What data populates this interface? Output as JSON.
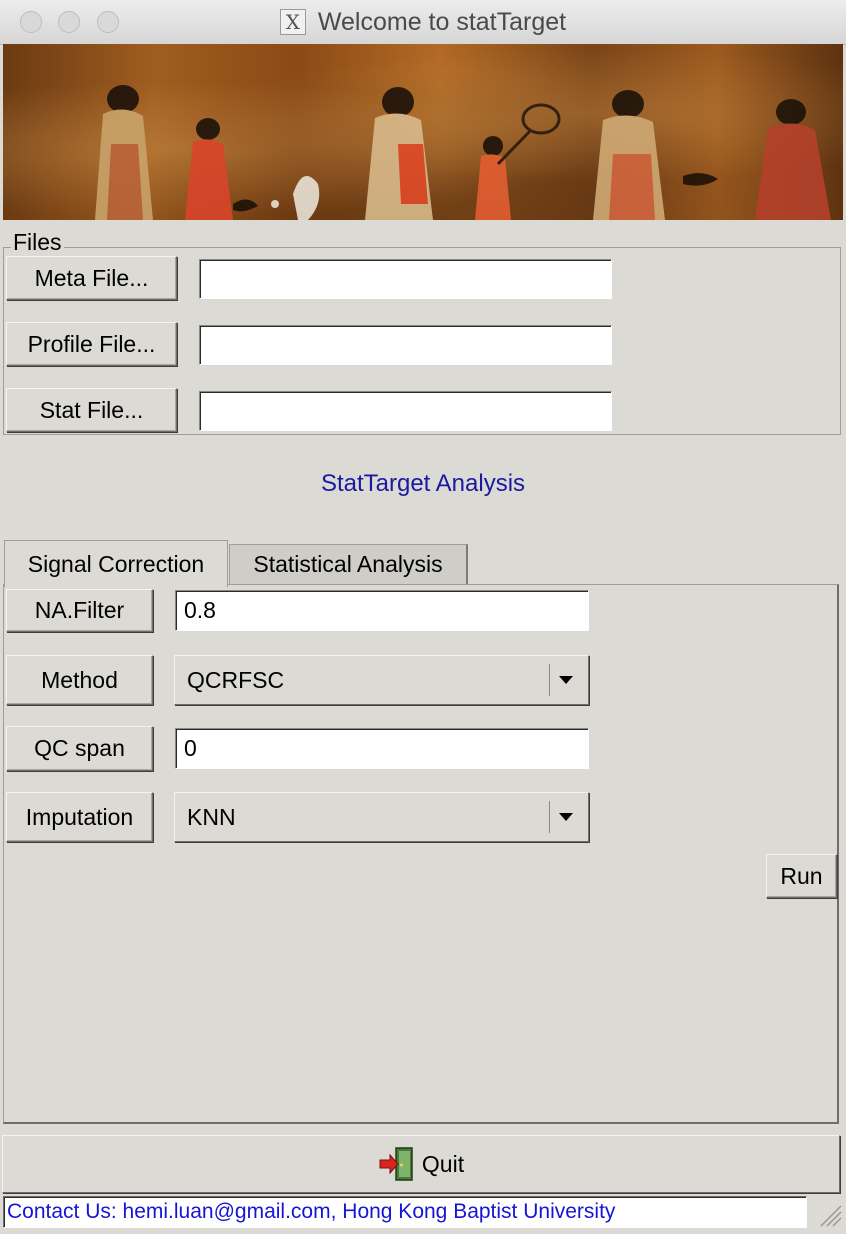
{
  "window": {
    "title": "Welcome to statTarget",
    "x11_icon": "X"
  },
  "files": {
    "legend": "Files",
    "meta_button": "Meta File...",
    "meta_value": "",
    "profile_button": "Profile File...",
    "profile_value": "",
    "stat_button": "Stat File...",
    "stat_value": ""
  },
  "section_title": "StatTarget Analysis",
  "tabs": [
    {
      "label": "Signal Correction",
      "active": true
    },
    {
      "label": "Statistical Analysis",
      "active": false
    }
  ],
  "signal_correction": {
    "na_filter_label": "NA.Filter",
    "na_filter_value": "0.8",
    "method_label": "Method",
    "method_value": "QCRFSC",
    "qc_span_label": "QC span",
    "qc_span_value": "0",
    "imputation_label": "Imputation",
    "imputation_value": "KNN",
    "run_label": "Run"
  },
  "quit_label": "Quit",
  "status_text": "Contact Us: hemi.luan@gmail.com, Hong Kong Baptist University",
  "colors": {
    "background": "#dcdad5",
    "section_title": "#1a1aa0",
    "status_text": "#1515d8"
  },
  "icons": [
    "x11-window-icon",
    "exit-door-icon",
    "resize-grip-icon",
    "dropdown-arrow-icon"
  ]
}
